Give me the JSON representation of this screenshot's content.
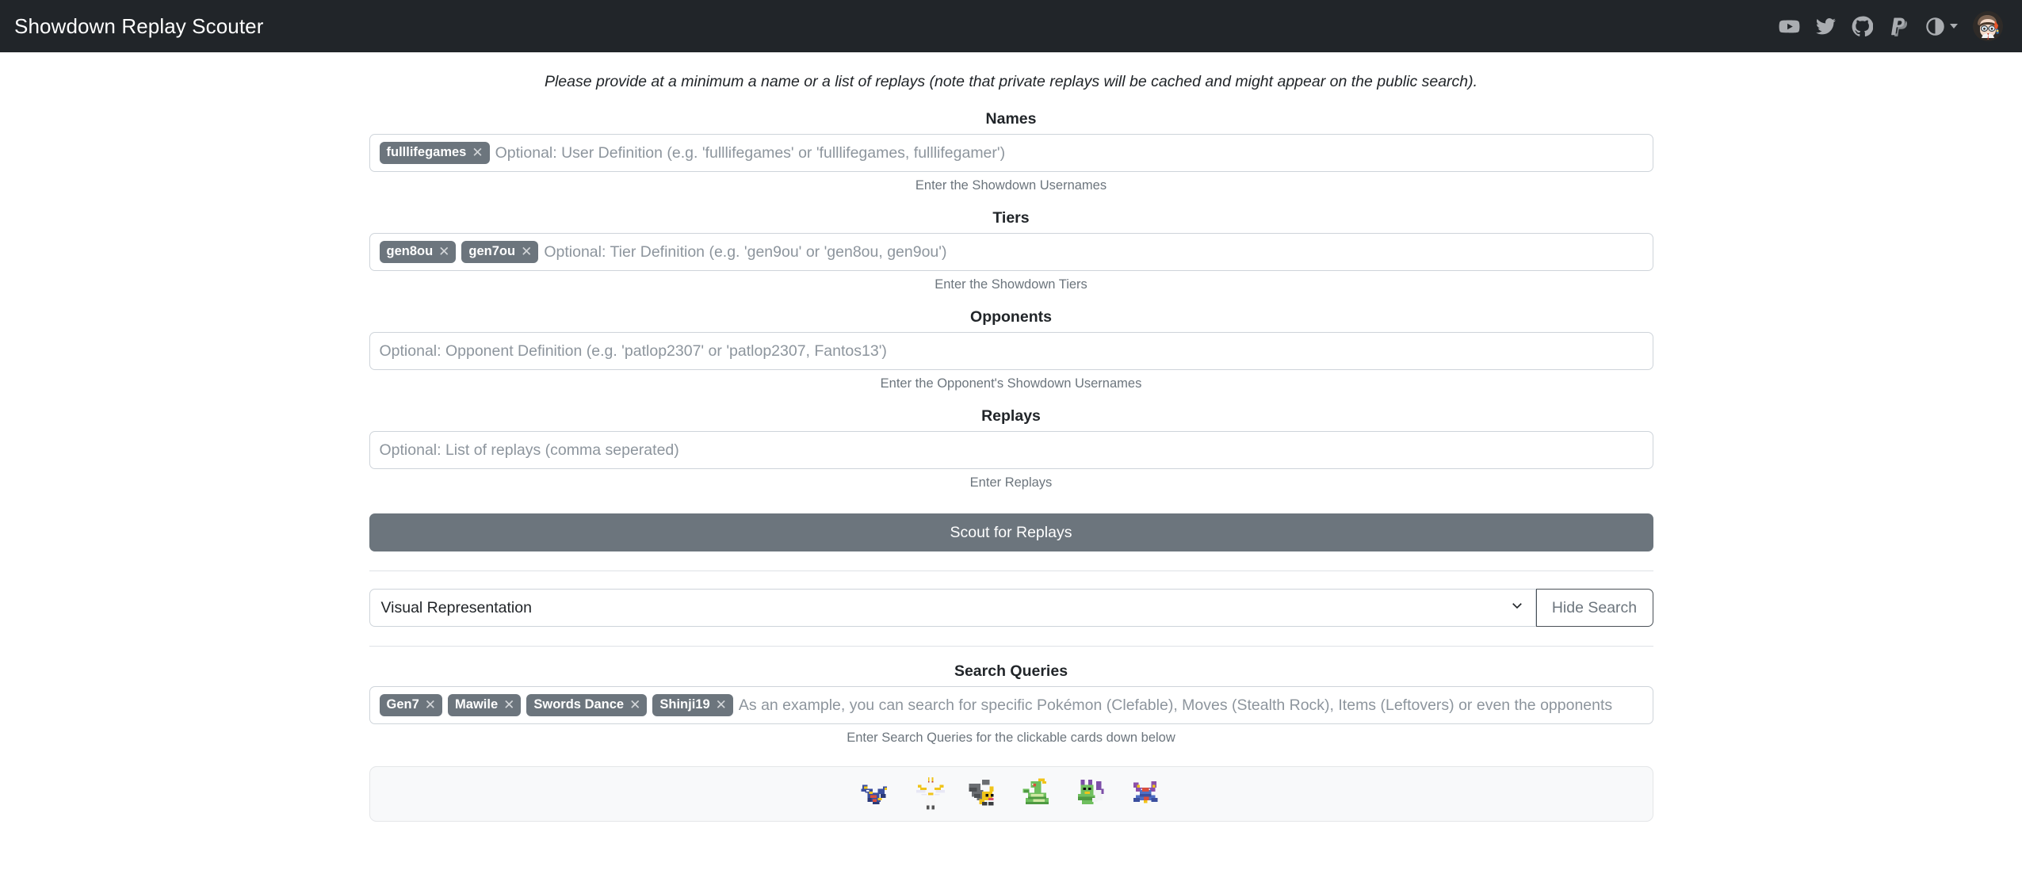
{
  "navbar": {
    "brand": "Showdown Replay Scouter",
    "icons": [
      {
        "name": "youtube-icon",
        "label": "YouTube"
      },
      {
        "name": "twitter-icon",
        "label": "Twitter"
      },
      {
        "name": "github-icon",
        "label": "GitHub"
      },
      {
        "name": "paypal-icon",
        "label": "PayPal"
      }
    ],
    "theme_toggle": {
      "name": "theme-contrast-icon",
      "label": "Toggle theme"
    },
    "avatar": {
      "name": "user-avatar",
      "label": "User avatar"
    },
    "colors": {
      "background": "#212529",
      "icon": "#aaadb1",
      "brand_text": "#ffffff"
    }
  },
  "intro": "Please provide at a minimum a name or a list of replays (note that private replays will be cached and might appear on the public search).",
  "fields": {
    "names": {
      "label": "Names",
      "chips": [
        "fulllifegames"
      ],
      "placeholder": "Optional: User Definition (e.g. 'fulllifegames' or 'fulllifegames, fulllifegamer')",
      "help": "Enter the Showdown Usernames"
    },
    "tiers": {
      "label": "Tiers",
      "chips": [
        "gen8ou",
        "gen7ou"
      ],
      "placeholder": "Optional: Tier Definition (e.g. 'gen9ou' or 'gen8ou, gen9ou')",
      "help": "Enter the Showdown Tiers"
    },
    "opponents": {
      "label": "Opponents",
      "chips": [],
      "placeholder": "Optional: Opponent Definition (e.g. 'patlop2307' or 'patlop2307, Fantos13')",
      "help": "Enter the Opponent's Showdown Usernames"
    },
    "replays": {
      "label": "Replays",
      "chips": [],
      "placeholder": "Optional: List of replays (comma seperated)",
      "help": "Enter Replays"
    },
    "search_queries": {
      "label": "Search Queries",
      "chips": [
        "Gen7",
        "Mawile",
        "Swords Dance",
        "Shinji19"
      ],
      "placeholder": "As an example, you can search for specific Pokémon (Clefable), Moves (Stealth Rock), Items (Leftovers) or even the opponents",
      "help": "Enter Search Queries for the clickable cards down below"
    }
  },
  "scout_button": {
    "label": "Scout for Replays",
    "color": "#6c757d"
  },
  "view_select": {
    "value": "Visual Representation",
    "chevron": "chevron-down-icon"
  },
  "hide_search_button": {
    "label": "Hide Search"
  },
  "sprites": [
    {
      "name": "sprite-garchomp",
      "label": "Garchomp"
    },
    {
      "name": "sprite-pheromosa",
      "label": "Pheromosa"
    },
    {
      "name": "sprite-mawile",
      "label": "Mawile"
    },
    {
      "name": "sprite-serperior",
      "label": "Serperior"
    },
    {
      "name": "sprite-tornadus",
      "label": "Tornadus"
    },
    {
      "name": "sprite-mega-garchomp",
      "label": "Mega Garchomp"
    }
  ]
}
